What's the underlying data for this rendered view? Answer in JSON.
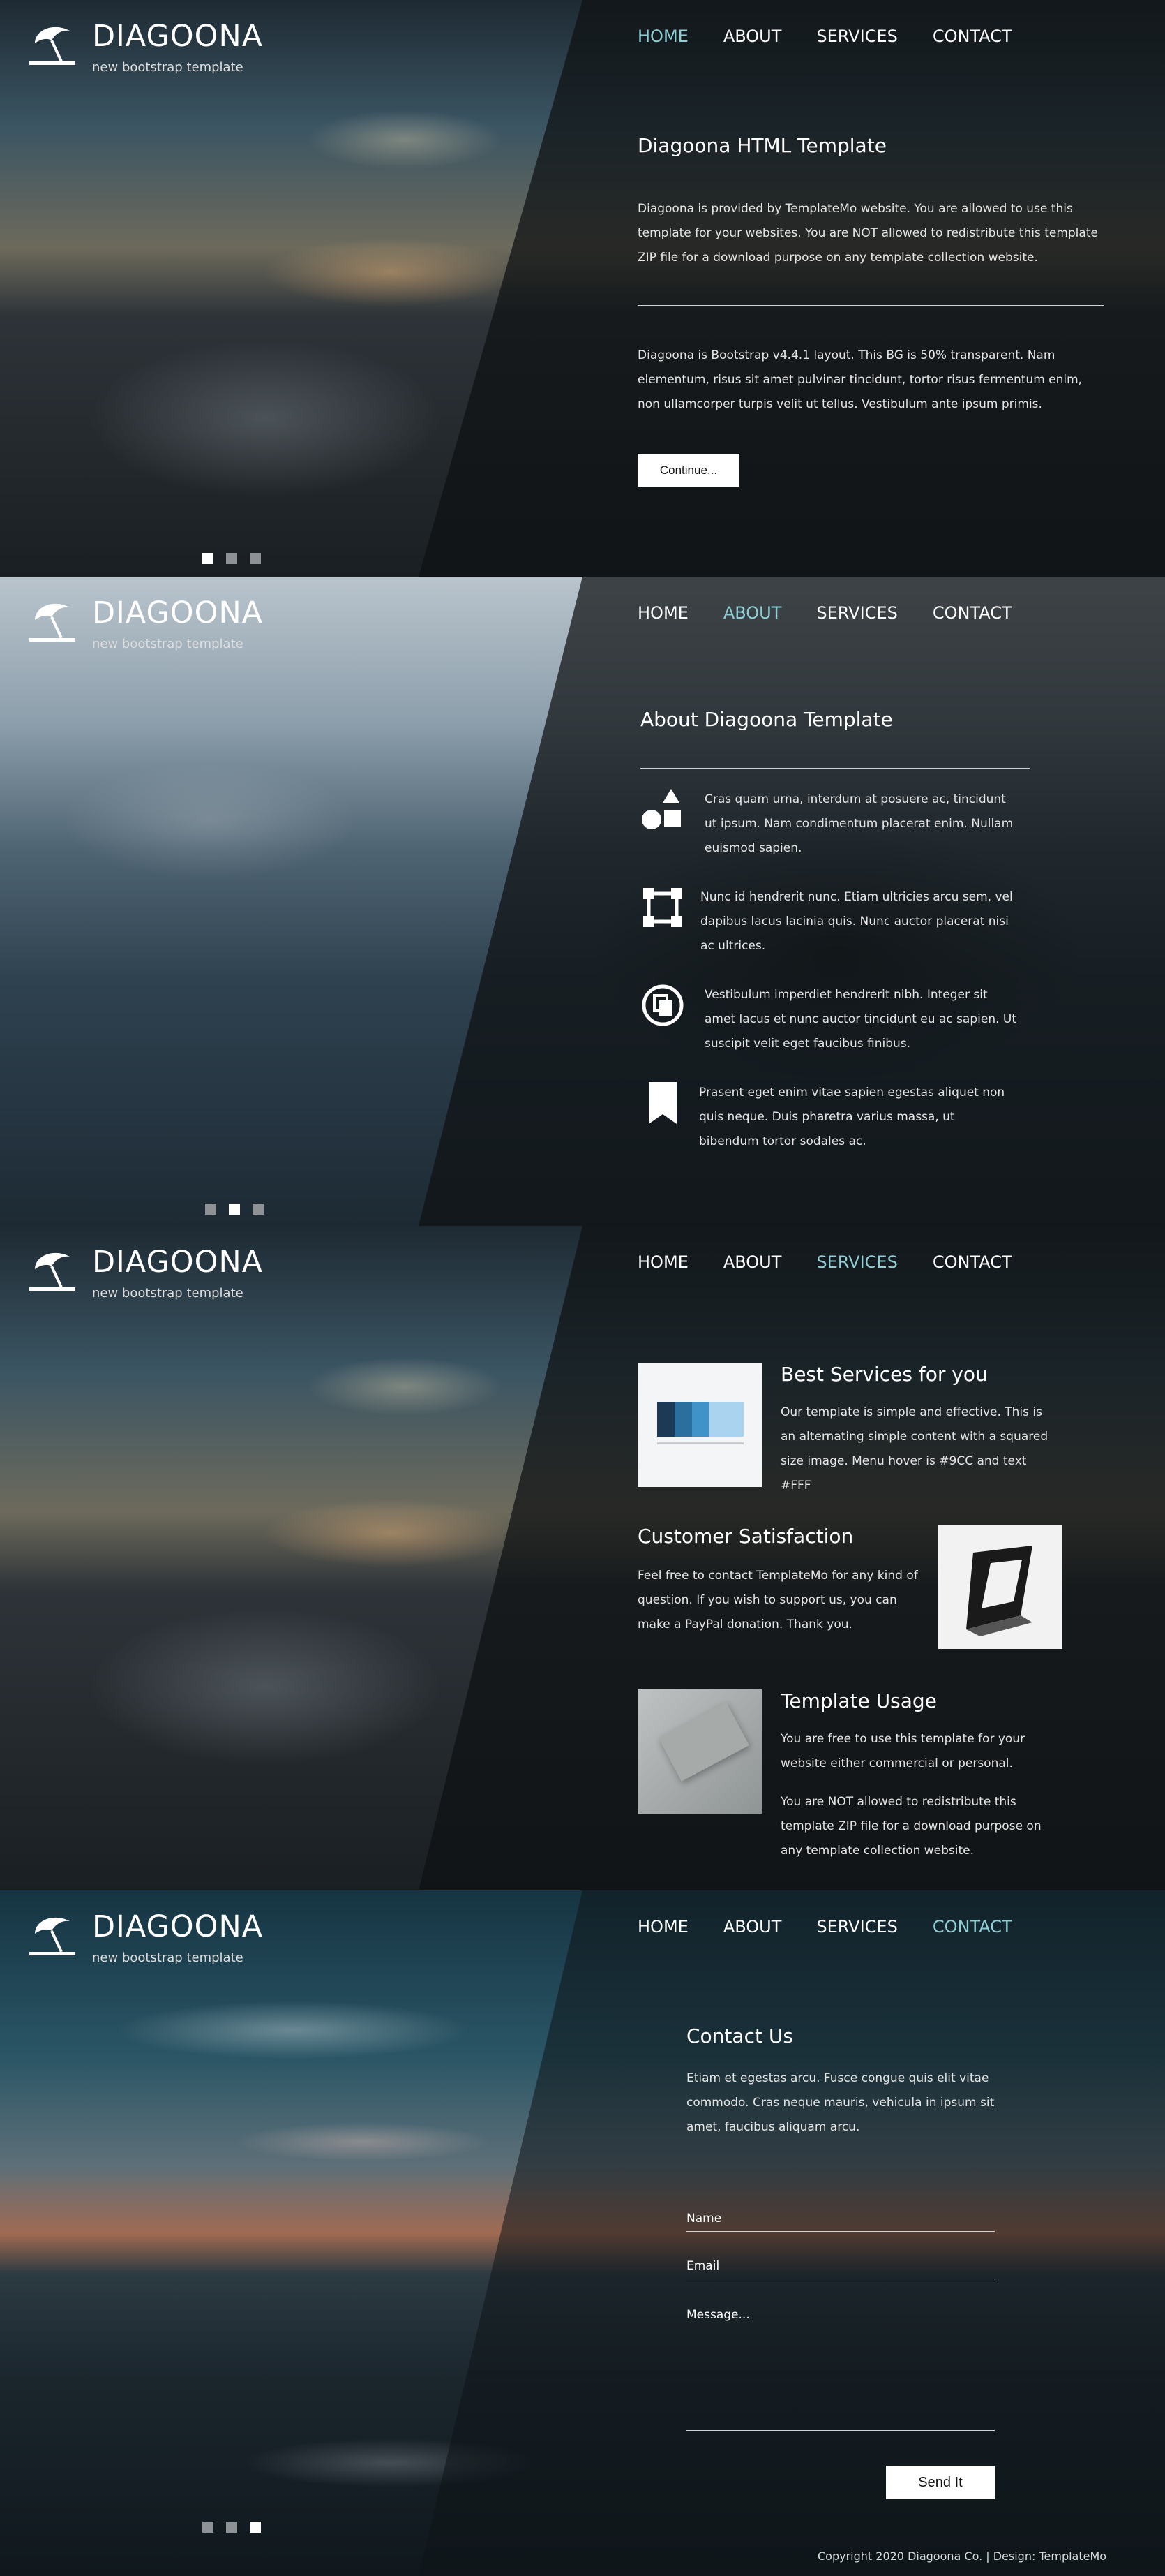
{
  "brand": {
    "title": "DIAGOONA",
    "subtitle": "new bootstrap template"
  },
  "nav": [
    "HOME",
    "ABOUT",
    "SERVICES",
    "CONTACT"
  ],
  "home": {
    "title": "Diagoona HTML Template",
    "p1": "Diagoona is provided by TemplateMo website. You are allowed to use this template for your websites. You are NOT allowed to redistribute this template ZIP file for a download purpose on any template collection website.",
    "p2": "Diagoona is Bootstrap v4.4.1 layout. This BG is 50% transparent. Nam elementum, risus sit amet pulvinar tincidunt, tortor risus fermentum enim, non ullamcorper turpis velit ut tellus. Vestibulum ante ipsum primis.",
    "button": "Continue..."
  },
  "about": {
    "title": "About Diagoona Template",
    "features": [
      {
        "icon": "shapes-icon",
        "text": "Cras quam urna, interdum at posuere ac, tincidunt ut ipsum. Nam condimentum placerat enim. Nullam euismod sapien."
      },
      {
        "icon": "vector-square-icon",
        "text": "Nunc id hendrerit nunc. Etiam ultricies arcu sem, vel dapibus lacus lacinia quis. Nunc auctor placerat nisi ac ultrices."
      },
      {
        "icon": "copy-circle-icon",
        "text": "Vestibulum imperdiet hendrerit nibh. Integer sit amet lacus et nunc auctor tincidunt eu ac sapien. Ut suscipit velit eget faucibus finibus."
      },
      {
        "icon": "bookmark-icon",
        "text": "Prasent eget enim vitae sapien egestas aliquet non quis neque. Duis pharetra varius massa, ut bibendum tortor sodales ac."
      }
    ]
  },
  "services": {
    "items": [
      {
        "title": "Best Services for you",
        "p1": "Our template is simple and effective. This is an alternating simple content with a squared size image. Menu hover is #9CC and text #FFF"
      },
      {
        "title": "Customer Satisfaction",
        "p1": "Feel free to contact TemplateMo for any kind of question. If you wish to support us, you can make a PayPal donation. Thank you."
      },
      {
        "title": "Template Usage",
        "p1": "You are free to use this template for your website either commercial or personal.",
        "p2": "You are NOT allowed to redistribute this template ZIP file for a download purpose on any template collection website."
      }
    ]
  },
  "contact": {
    "title": "Contact Us",
    "text": "Etiam et egestas arcu. Fusce congue quis elit vitae commodo. Cras neque mauris, vehicula in ipsum sit amet, faucibus aliquam arcu.",
    "name_placeholder": "Name",
    "email_placeholder": "Email",
    "message_placeholder": "Message...",
    "button": "Send It",
    "footer": "Copyright 2020 Diagoona Co. | Design: TemplateMo"
  },
  "colors": {
    "accent": "#8ecfd6",
    "veil": "#0e1012"
  }
}
